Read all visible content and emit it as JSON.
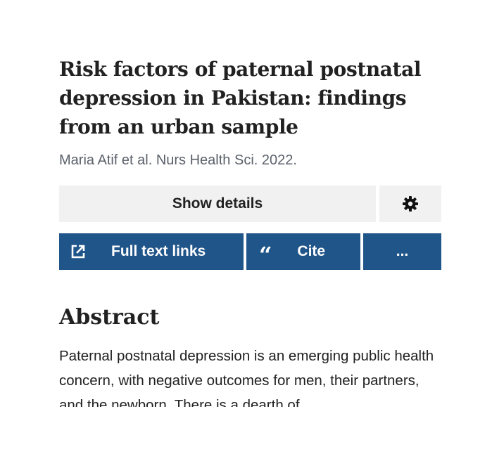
{
  "article": {
    "title": "Risk factors of paternal postnatal depression in Pakistan: findings from an urban sample",
    "byline": "Maria Atif et al. Nurs Health Sci. 2022."
  },
  "buttons": {
    "show_details": "Show details",
    "settings_icon": "gear-icon",
    "full_text_links": "Full text links",
    "full_text_icon": "external-link-icon",
    "cite": "Cite",
    "cite_icon": "quote-icon",
    "more": "..."
  },
  "abstract": {
    "heading": "Abstract",
    "text": "Paternal postnatal depression is an emerging public health concern, with negative outcomes for men, their partners, and the newborn. There is a dearth of"
  },
  "colors": {
    "primary_button": "#20558a",
    "secondary_button": "#f1f1f1",
    "text": "#212121",
    "muted_text": "#5b616b"
  }
}
